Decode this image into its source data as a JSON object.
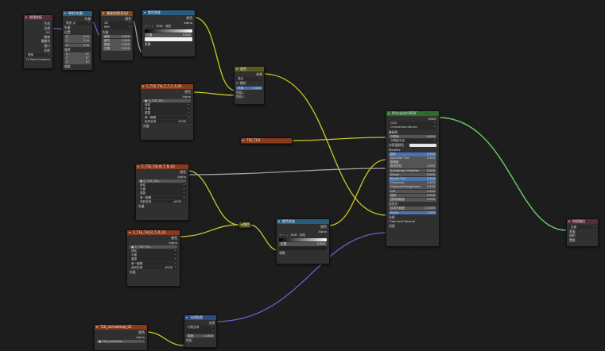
{
  "colors": {
    "shader_wire": "#63c763",
    "color_wire": "#c7c729",
    "float_wire": "#a1a1a1",
    "vector_wire": "#6363c7"
  },
  "texcoord": {
    "title": "纹理坐标",
    "outputs": [
      "生成",
      "法线",
      "UV",
      "物体",
      "摄像机",
      "窗口",
      "反射"
    ],
    "object_label": "物体",
    "from_instancer": "From Instancer"
  },
  "mapping": {
    "title": "映射(矢量)",
    "out": "矢量",
    "type_label": "类型",
    "type_value": "点",
    "vec_label": "矢量",
    "loc_label": "位置",
    "rot_label": "旋转",
    "scale_label": "缩放",
    "loc": [
      {
        "k": "X",
        "v": "0 m"
      },
      {
        "k": "Y",
        "v": "0 m"
      },
      {
        "k": "Z",
        "v": "0 m"
      }
    ],
    "rot": [
      {
        "k": "X",
        "v": "0°"
      },
      {
        "k": "Y",
        "v": "0°"
      },
      {
        "k": "Z",
        "v": "0°"
      }
    ],
    "scale": [
      {
        "k": "X",
        "v": "1.000"
      },
      {
        "k": "Y",
        "v": "5.600"
      },
      {
        "k": "Z",
        "v": "6.700"
      }
    ]
  },
  "noise": {
    "title": "噪波纹理(扰动)",
    "out": "颜色",
    "dim": "3D",
    "type": "fBM",
    "vec": "矢量",
    "fields": [
      {
        "k": "缩放",
        "v": "2.000"
      },
      {
        "k": "细节",
        "v": "2.000"
      },
      {
        "k": "糙度",
        "v": "2.000"
      },
      {
        "k": "空隙",
        "v": "2.000"
      }
    ]
  },
  "ramp1": {
    "title": "颜色渐变",
    "outs": [
      "颜色",
      "Alpha"
    ],
    "mode": "RGB",
    "interp": "线性",
    "pos_label": "位置",
    "pos_value": "0.000",
    "input": "系数"
  },
  "img1": {
    "title": "C_T1E_Ti4_T_T_F_P_01",
    "outs": [
      "颜色",
      "Alpha"
    ],
    "file": "C_T1E_Ti4...",
    "rows": [
      "线性",
      "平面",
      "重复",
      "单一图像"
    ],
    "cs_label": "色彩空间",
    "cs_value": "sRGB",
    "input": "矢量"
  },
  "mix": {
    "title": "混合",
    "out": "结果",
    "mode1": "混合",
    "mode2": "颜色",
    "clamp": "钳制",
    "fac_label": "系数",
    "fac_value": "1.000",
    "in_a": "色彩1",
    "in_b": "色彩2"
  },
  "attr": {
    "title": "T1E_TEX"
  },
  "img2": {
    "title": "C_T1E_Ti4_N_T_N_03",
    "outs": [
      "颜色",
      "Alpha"
    ],
    "file": "C_T1E_Ti4...",
    "rows": [
      "线性",
      "平面",
      "重复",
      "单一图像"
    ],
    "cs_label": "色彩空间",
    "cs_value": "sRGB",
    "input": "矢量"
  },
  "img3": {
    "title": "C_T1E_Ti4_R_T_R_03",
    "outs": [
      "颜色",
      "Alpha"
    ],
    "file": "C_T1E_Ti4...",
    "rows": [
      "线性",
      "平面",
      "重复",
      "单一图像"
    ],
    "cs_label": "色彩空间",
    "cs_value": "sRGB",
    "input": "矢量"
  },
  "reroute": {
    "label": "颜色"
  },
  "ramp2": {
    "title": "颜色渐变",
    "outs": [
      "颜色",
      "Alpha"
    ],
    "mode": "RGB",
    "interp": "线性",
    "pos_label": "位置",
    "pos_value": "0.800",
    "input": "系数"
  },
  "bsdf": {
    "title": "Principled BSDF",
    "out": "BSDF",
    "dist": "GGX",
    "sss": "Christensen-Burley",
    "base": "基础色",
    "sss_rows": [
      "次表面",
      "次表面半径",
      "次表面颜色"
    ],
    "metallic": "Metallic",
    "fields": [
      {
        "k": "高光",
        "v": "0.500",
        "c": "blue"
      },
      {
        "k": "Specular Tint",
        "v": "0.000",
        "c": ""
      },
      {
        "k": "粗糙度",
        "v": "",
        "c": ""
      },
      {
        "k": "各向异性",
        "v": "0.000",
        "c": ""
      },
      {
        "k": "Anisotropic Rotation",
        "v": "0.000",
        "c": ""
      },
      {
        "k": "Sheen",
        "v": "0.000",
        "c": ""
      },
      {
        "k": "Sheen Tint",
        "v": "0.500",
        "c": "blue"
      },
      {
        "k": "Clearcoat",
        "v": "0.000",
        "c": ""
      },
      {
        "k": "Clearcoat Roughness",
        "v": "0.030",
        "c": ""
      },
      {
        "k": "IOR",
        "v": "1.450",
        "c": ""
      },
      {
        "k": "透射",
        "v": "0.000",
        "c": ""
      },
      {
        "k": "透射粗糙度",
        "v": "0.000",
        "c": ""
      }
    ],
    "emission": "自发光",
    "emstr_label": "自发光强度",
    "emstr_value": "27.000",
    "alpha_label": "Alpha",
    "alpha_value": "1.000",
    "tail": [
      "法线",
      "Clearcoat Normal",
      "切线"
    ]
  },
  "output": {
    "title": "材质输出",
    "target": "全部",
    "ins": [
      "表面",
      "体积",
      "置换"
    ]
  },
  "normal": {
    "title": "法线贴图",
    "out": "法线",
    "space": "切线空间",
    "str_label": "强度",
    "str_value": "1.000",
    "in": "色彩"
  },
  "img4": {
    "title": "T1E_normalmap_02",
    "outs": [
      "颜色",
      "Alpha"
    ],
    "file": "T1E_normalm..."
  }
}
